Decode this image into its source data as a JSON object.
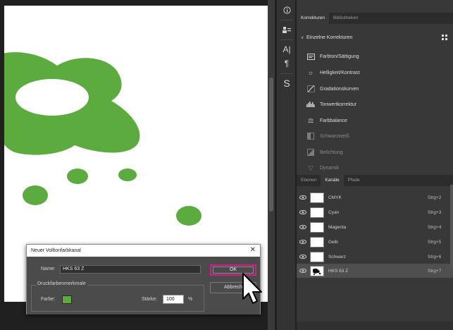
{
  "colors": {
    "accent_magenta": "#d61b8a",
    "spot_green": "#5cab3f"
  },
  "toolstrip": {
    "items": [
      {
        "name": "info-icon",
        "glyph": "ⓘ"
      },
      {
        "name": "person-icon",
        "glyph": ""
      },
      {
        "name": "character-icon",
        "glyph": "A|"
      },
      {
        "name": "paragraph-icon",
        "glyph": "¶"
      },
      {
        "name": "styles-icon",
        "glyph": "S"
      }
    ]
  },
  "adjustments_panel": {
    "tabs": [
      {
        "label": "Korrekturen",
        "active": true
      },
      {
        "label": "Bibliotheken",
        "active": false
      }
    ],
    "section_title": "Einzelne Korrekturen",
    "items": [
      {
        "label": "Farbton/Sättigung",
        "icon": "hue-saturation-icon",
        "enabled": true
      },
      {
        "label": "Helligkeit/Kontrast",
        "icon": "brightness-contrast-icon",
        "enabled": true
      },
      {
        "label": "Gradationskurven",
        "icon": "curves-icon",
        "enabled": true
      },
      {
        "label": "Tonwertkorrektur",
        "icon": "levels-icon",
        "enabled": true
      },
      {
        "label": "Farbbalance",
        "icon": "color-balance-icon",
        "enabled": true
      },
      {
        "label": "Schwarzweiß",
        "icon": "black-white-icon",
        "enabled": false
      },
      {
        "label": "Belichtung",
        "icon": "exposure-icon",
        "enabled": false
      },
      {
        "label": "Dynamik",
        "icon": "vibrance-icon",
        "enabled": false
      }
    ]
  },
  "channels_panel": {
    "tabs": [
      {
        "label": "Ebenen",
        "active": false
      },
      {
        "label": "Kanäle",
        "active": true
      },
      {
        "label": "Pfade",
        "active": false
      }
    ],
    "channels": [
      {
        "name": "CMYK",
        "shortcut": "Strg+2",
        "selected": false
      },
      {
        "name": "Cyan",
        "shortcut": "Strg+3",
        "selected": false
      },
      {
        "name": "Magenta",
        "shortcut": "Strg+4",
        "selected": false
      },
      {
        "name": "Gelb",
        "shortcut": "Strg+5",
        "selected": false
      },
      {
        "name": "Schwarz",
        "shortcut": "Strg+6",
        "selected": false
      },
      {
        "name": "HKS 63 Z",
        "shortcut": "Strg+7",
        "selected": true
      }
    ]
  },
  "dialog": {
    "title": "Neuer Volltonfarbkanal",
    "name_label": "Name:",
    "name_value": "HKS 63 Z",
    "group_label": "Druckfarbenmerkmale",
    "color_label": "Farbe:",
    "solidity_label": "Stärke:",
    "solidity_value": "100",
    "solidity_unit": "%",
    "ok_label": "OK",
    "cancel_label": "Abbrech"
  }
}
